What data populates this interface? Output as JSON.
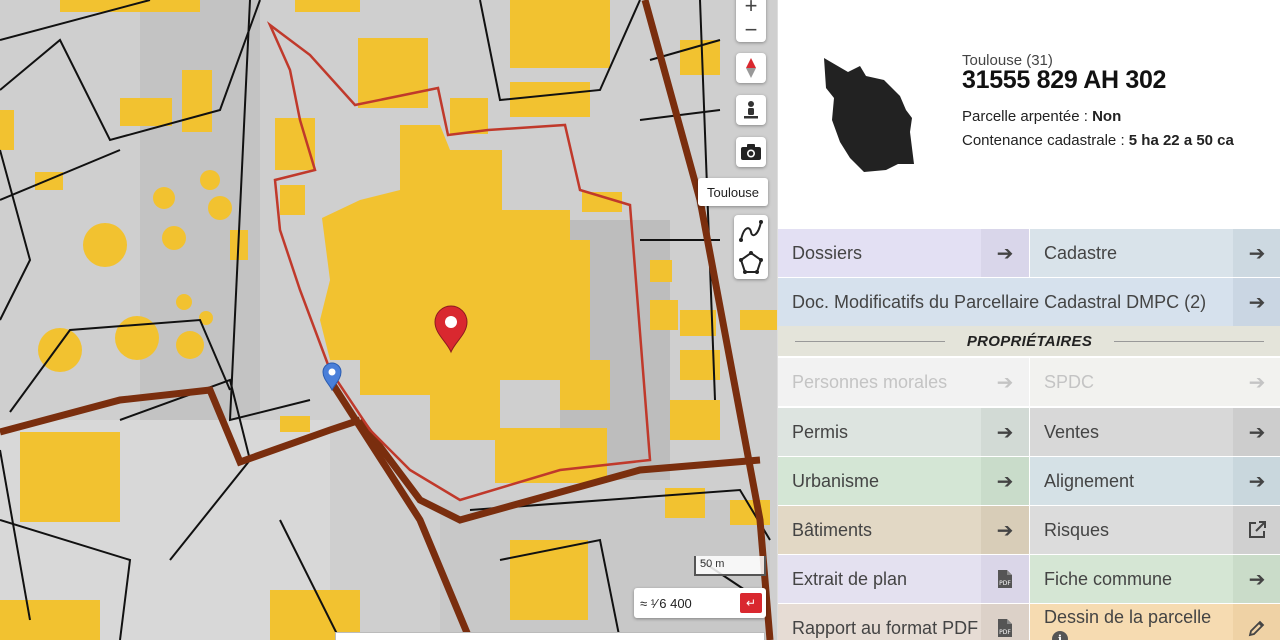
{
  "map": {
    "zoom_in": "+",
    "zoom_out": "−",
    "city_label": "Toulouse",
    "scale_bar_label": "50 m",
    "scale_prefix": "≈ ¹⁄",
    "scale_value": "6 400",
    "scale_go": "↵",
    "colors": {
      "building": "#f2c230",
      "parcel_outline": "#c0392b",
      "boundary": "#7a2e0e",
      "background": "#cfcfcf"
    }
  },
  "parcel": {
    "commune": "Toulouse (31)",
    "id": "31555 829 AH 302",
    "surveyed_label": "Parcelle arpentée : ",
    "surveyed_value": "Non",
    "area_label": "Contenance cadastrale : ",
    "area_value": "5 ha 22 a 50 ca"
  },
  "menu": {
    "dossiers": "Dossiers",
    "cadastre": "Cadastre",
    "dmpc": "Doc. Modificatifs du Parcellaire Cadastral DMPC (2)",
    "section_proprietaires": "PROPRIÉTAIRES",
    "personnes_morales": "Personnes morales",
    "spdc": "SPDC",
    "permis": "Permis",
    "ventes": "Ventes",
    "urbanisme": "Urbanisme",
    "alignement": "Alignement",
    "batiments": "Bâtiments",
    "risques": "Risques",
    "extrait_plan": "Extrait de plan",
    "fiche_commune": "Fiche commune",
    "rapport_pdf": "Rapport au format PDF",
    "dessin_parcelle": "Dessin de la parcelle"
  },
  "icons": {
    "arrow": "arrow-right-icon",
    "external": "external-link-icon",
    "pdf": "pdf-file-icon",
    "pencil": "pencil-icon",
    "info": "info-icon"
  }
}
